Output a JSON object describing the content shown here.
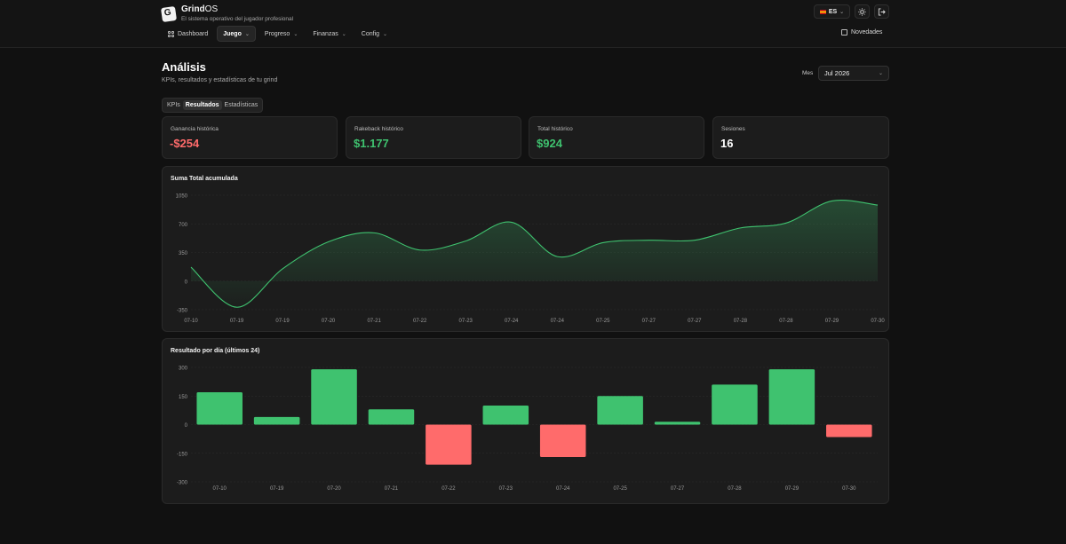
{
  "app": {
    "name_main": "Grind",
    "name_suffix": "OS",
    "tagline": "El sistema operativo del jugador profesional"
  },
  "header": {
    "language": "ES",
    "theme_icon": "sun-icon",
    "logout_icon": "logout-icon",
    "news_label": "Novedades"
  },
  "nav": {
    "items": [
      {
        "label": "Dashboard",
        "active": false,
        "dropdown": false
      },
      {
        "label": "Juego",
        "active": true,
        "dropdown": true
      },
      {
        "label": "Progreso",
        "active": false,
        "dropdown": true
      },
      {
        "label": "Finanzas",
        "active": false,
        "dropdown": true
      },
      {
        "label": "Config",
        "active": false,
        "dropdown": true
      }
    ]
  },
  "page": {
    "title": "Análisis",
    "subtitle": "KPIs, resultados y estadísticas de tu grind",
    "month_label": "Mes",
    "month_value": "Jul 2026"
  },
  "tabs": [
    "KPIs",
    "Resultados",
    "Estadísticas"
  ],
  "active_tab": "Resultados",
  "kpis": [
    {
      "label": "Ganancia histórica",
      "value": "-$254",
      "tone": "neg"
    },
    {
      "label": "Rakeback histórico",
      "value": "$1.177",
      "tone": "pos"
    },
    {
      "label": "Total histórico",
      "value": "$924",
      "tone": "pos"
    },
    {
      "label": "Sesiones",
      "value": "16",
      "tone": "neu"
    }
  ],
  "colors": {
    "positive": "#3fc26f",
    "negative": "#ff6b6b",
    "line": "#3fc26f",
    "grid": "#2b2b2b"
  },
  "chart_data": [
    {
      "type": "area",
      "title": "Suma Total acumulada",
      "x": [
        "07-10",
        "07-19",
        "07-19",
        "07-20",
        "07-21",
        "07-22",
        "07-23",
        "07-24",
        "07-24",
        "07-25",
        "07-27",
        "07-27",
        "07-28",
        "07-28",
        "07-29",
        "07-30"
      ],
      "series": [
        {
          "values": [
            170,
            -320,
            150,
            480,
            590,
            380,
            490,
            720,
            300,
            470,
            500,
            500,
            650,
            710,
            980,
            930
          ]
        }
      ],
      "yticks": [
        1050,
        700,
        350,
        0,
        -350
      ],
      "ylim": [
        -350,
        1050
      ],
      "grid": true
    },
    {
      "type": "bar",
      "title": "Resultado por día (últimos 24)",
      "categories": [
        "07-10",
        "07-19",
        "07-20",
        "07-21",
        "07-22",
        "07-23",
        "07-24",
        "07-25",
        "07-27",
        "07-28",
        "07-29",
        "07-30"
      ],
      "values": [
        170,
        40,
        290,
        80,
        -210,
        100,
        -170,
        150,
        15,
        210,
        290,
        -65
      ],
      "yticks": [
        300,
        150,
        0,
        -150,
        -300
      ],
      "ylim": [
        -300,
        300
      ],
      "grid": true
    }
  ]
}
